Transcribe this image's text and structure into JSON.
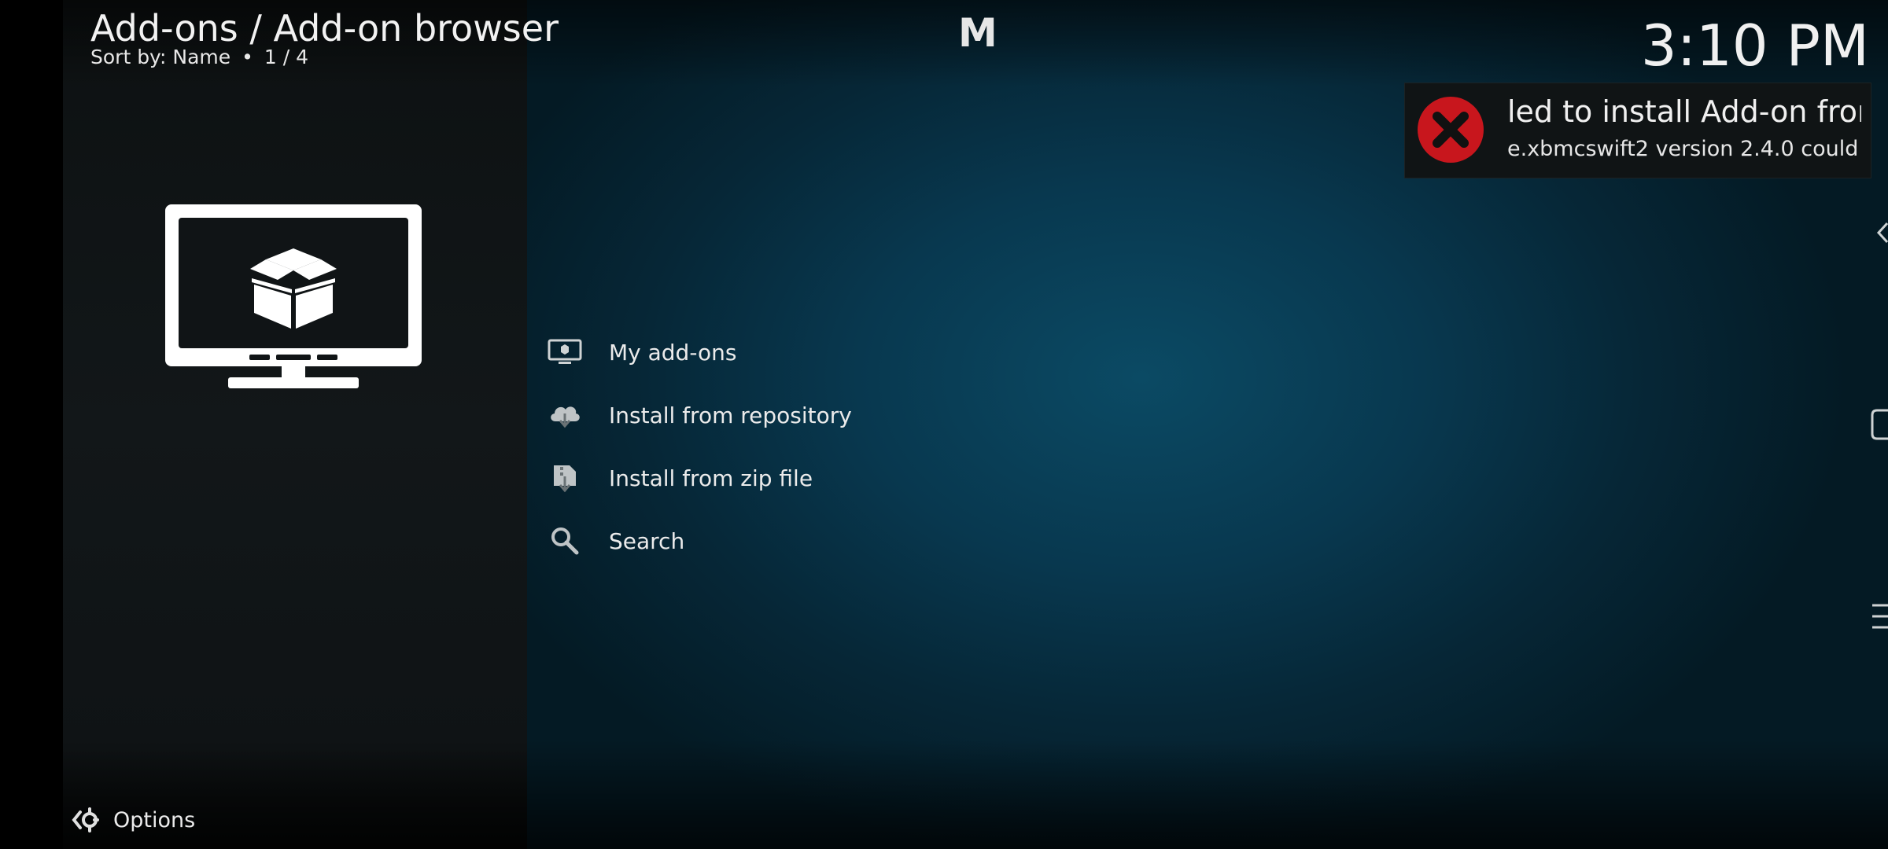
{
  "header": {
    "title": "Add-ons / Add-on browser",
    "sort_label": "Sort by: Name",
    "separator": "•",
    "page_count": "1 / 4"
  },
  "top_letter": "M",
  "clock": "3:10 PM",
  "notification": {
    "icon": "error-x-icon",
    "title": "led to install Add-on fron",
    "message": "e.xbmcswift2 version 2.4.0 could",
    "accent_color": "#c8161d"
  },
  "menu": {
    "items": [
      {
        "label": "My add-ons",
        "icon": "monitor-addons-icon"
      },
      {
        "label": "Install from repository",
        "icon": "cloud-download-icon"
      },
      {
        "label": "Install from zip file",
        "icon": "zip-install-icon"
      },
      {
        "label": "Search",
        "icon": "search-icon"
      }
    ]
  },
  "footer": {
    "options_label": "Options",
    "options_icon": "options-gear-icon"
  }
}
